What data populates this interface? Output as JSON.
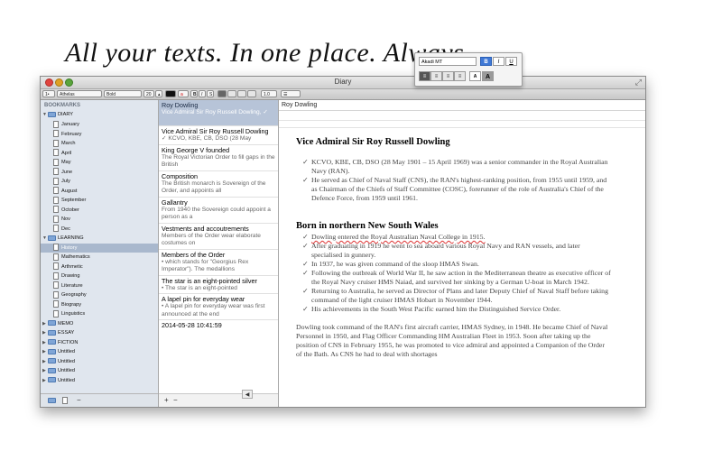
{
  "headline": "All your texts. In one place. Always.",
  "window": {
    "title": "Diary"
  },
  "toolbar": {
    "list_style": "1•",
    "font": "Athelas",
    "weight": "Bold",
    "size": "20",
    "bold": "B",
    "italic": "I",
    "underline": "S",
    "spacing": "1.0",
    "list_menu": "☰"
  },
  "sidebar": {
    "header": "BOOKMARKS",
    "diary": "DIARY",
    "diary_items": [
      "January",
      "February",
      "March",
      "April",
      "May",
      "June",
      "July",
      "August",
      "September",
      "October",
      "Nov",
      "Dec"
    ],
    "learning": "LEARNING",
    "learning_items": [
      "History",
      "Mathematics",
      "Arthmetic",
      "Drawing",
      "Literature",
      "Geography",
      "Biograpy",
      "Linguistics"
    ],
    "collapsed": [
      "MEMO",
      "ESSAY",
      "FICTION",
      "Untitled",
      "Untitled",
      "Untitled",
      "Untitled"
    ],
    "add": "+",
    "remove": "−"
  },
  "notes": {
    "items": [
      {
        "title": "Roy Dowling",
        "sub": "Vice Admiral Sir Roy Russell Dowling, ✓"
      },
      {
        "title": "Vice Admiral Sir Roy Russell Dowling",
        "sub": "✓ KCVO, KBE, CB, DSO (28 May"
      },
      {
        "title": "King George V founded",
        "sub": "The Royal Victorian Order to fill gaps in the British"
      },
      {
        "title": "Composition",
        "sub": "The British monarch is Sovereign of the Order, and appoints all"
      },
      {
        "title": "Gallantry",
        "sub": "From 1940 the Sovereign could appoint a person as a"
      },
      {
        "title": "Vestments and accoutrements",
        "sub": "Members of the Order wear elaborate costumes on"
      },
      {
        "title": "Members of the Order",
        "sub": "• which stands for \"Georgius Rex Imperator\"). The medallions"
      },
      {
        "title": "The star is an eight-pointed silver",
        "sub": "• The star is an eight-pointed"
      },
      {
        "title": "A lapel pin for everyday wear",
        "sub": "• A lapel pin for everyday wear was first announced at the end"
      },
      {
        "title": "2014-05-28 10:41:59",
        "sub": ""
      }
    ],
    "add": "+",
    "remove": "−"
  },
  "editor": {
    "header": "Roy Dowling",
    "heading1": "Vice Admiral Sir Roy Russell Dowling",
    "bullets1": [
      "KCVO, KBE, CB, DSO (28 May 1901 – 15 April 1969) was a senior commander in the Royal Australian Navy (RAN).",
      "He served as Chief of Naval Staff (CNS), the RAN's highest-ranking position, from 1955 until 1959, and as Chairman of the Chiefs of Staff Committee (COSC), forerunner of the role of Australia's Chief of the Defence Force, from 1959 until 1961."
    ],
    "heading2": "Born in northern New South Wales",
    "bullets2": [
      "Dowling entered the Royal Australian Naval College in 1915.",
      "After graduating in 1919 he went to sea aboard various Royal Navy and RAN vessels, and later specialised in gunnery.",
      "In 1937, he was given command of the sloop HMAS Swan.",
      "Following the outbreak of World War II, he saw action in the Mediterranean theatre as executive officer of the Royal Navy cruiser HMS Naiad, and survived her sinking by a German U-boat in March 1942.",
      "Returning to Australia, he served as Director of Plans and later Deputy Chief of Naval Staff before taking command of the light cruiser HMAS Hobart in November 1944.",
      "His achievements in the South West Pacific earned him the Distinguished Service Order."
    ],
    "paragraph": "Dowling took command of the RAN's first aircraft carrier, HMAS Sydney, in 1948. He became Chief of Naval Personnel in 1950, and Flag Officer Commanding HM Australian Fleet in 1953. Soon after taking up the position of CNS in February 1955, he was promoted to vice admiral and appointed a Companion of the Order of the Bath. As CNS he had to deal with shortages",
    "collapse": "◀"
  },
  "format_popup": {
    "font": "Akadi MT",
    "bold": "B",
    "italic": "I",
    "underline": "U",
    "align_left": "≡",
    "align_center": "≡",
    "align_right": "≡",
    "justify": "≡",
    "size_small": "A",
    "size_large": "A"
  }
}
